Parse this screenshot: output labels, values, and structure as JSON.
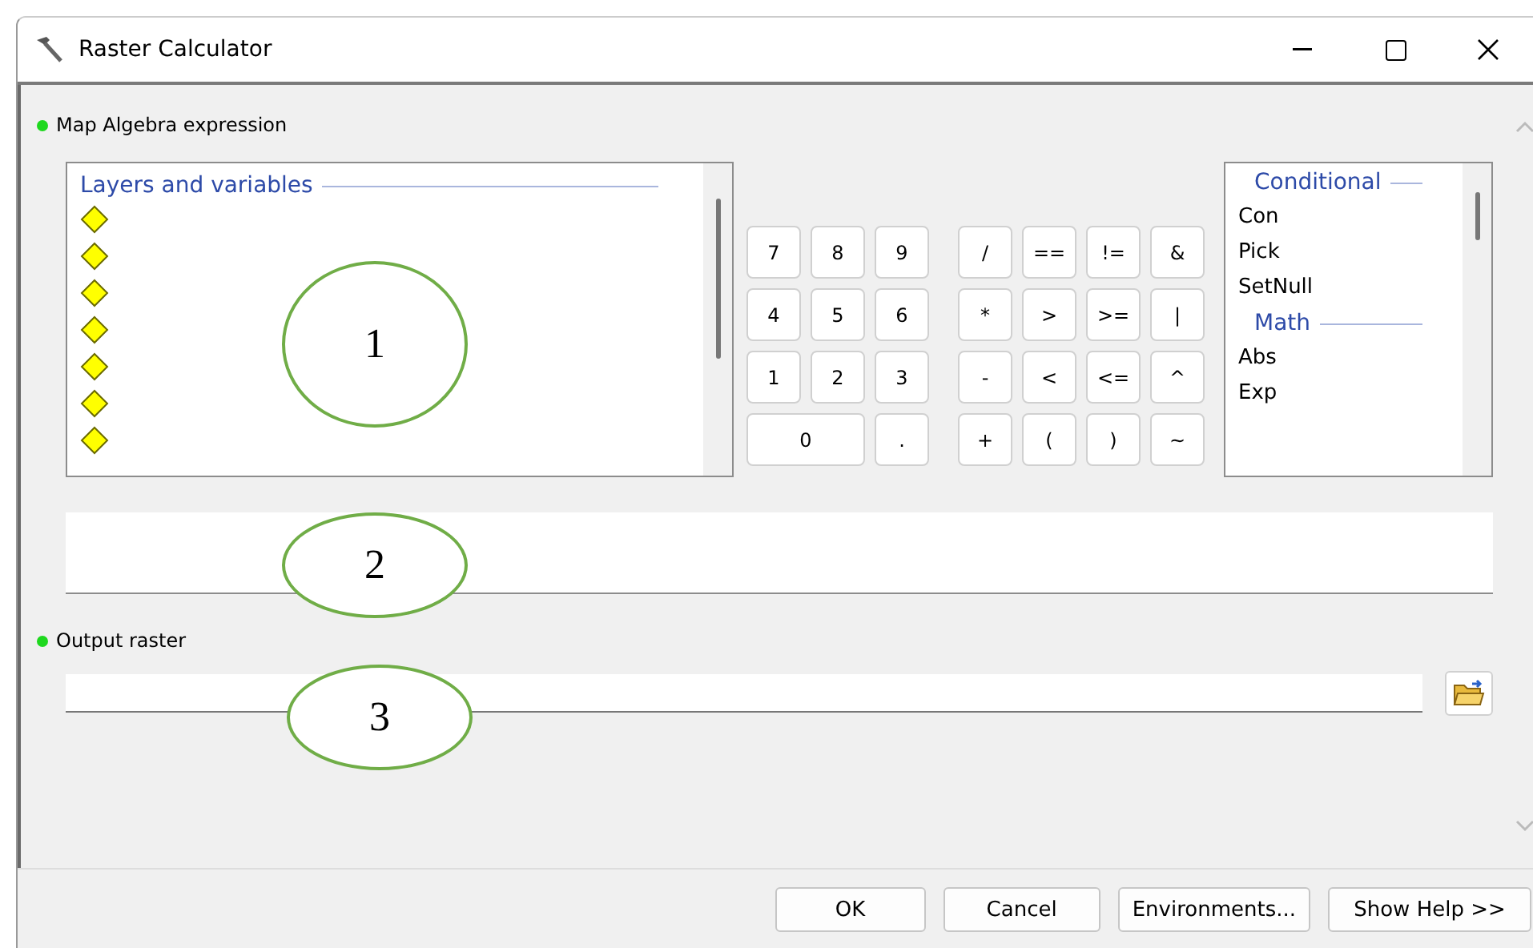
{
  "window": {
    "title": "Raster Calculator"
  },
  "expression_label": "Map Algebra expression",
  "layers": {
    "header": "Layers and variables",
    "items": [
      {
        "kind": "layer"
      },
      {
        "kind": "layer"
      },
      {
        "kind": "layer"
      },
      {
        "kind": "layer"
      },
      {
        "kind": "layer"
      },
      {
        "kind": "layer"
      },
      {
        "kind": "layer"
      }
    ]
  },
  "keypad": [
    [
      "7",
      "8",
      "9",
      "/",
      "==",
      "!=",
      "&"
    ],
    [
      "4",
      "5",
      "6",
      "*",
      ">",
      ">=",
      "|"
    ],
    [
      "1",
      "2",
      "3",
      "-",
      "<",
      "<=",
      "^"
    ],
    [
      "0",
      ".",
      "+",
      "(",
      ")",
      "~"
    ]
  ],
  "functions": [
    {
      "header": "Conditional",
      "items": [
        "Con",
        "Pick",
        "SetNull"
      ]
    },
    {
      "header": "Math",
      "items": [
        "Abs",
        "Exp"
      ]
    }
  ],
  "output_label": "Output raster",
  "callouts": [
    "1",
    "2",
    "3"
  ],
  "buttons": [
    "OK",
    "Cancel",
    "Environments...",
    "Show Help >>"
  ]
}
